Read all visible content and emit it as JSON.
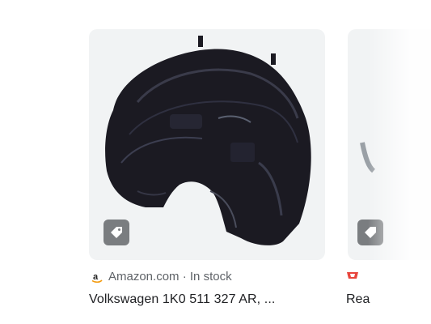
{
  "result": {
    "source_name": "Amazon.com",
    "separator": " · ",
    "availability": "In stock",
    "title": "Volkswagen 1K0 511 327 AR, ...",
    "icons": {
      "source": "amazon-logo-icon",
      "action": "tag-icon"
    }
  },
  "next_result": {
    "title_partial": "Rea",
    "icons": {
      "source": "store-logo-icon",
      "action": "tag-icon"
    }
  },
  "colors": {
    "card_bg": "#f1f3f4",
    "source_text": "#5f6368",
    "title_text": "#202124",
    "badge_bg": "#7a7d80"
  }
}
